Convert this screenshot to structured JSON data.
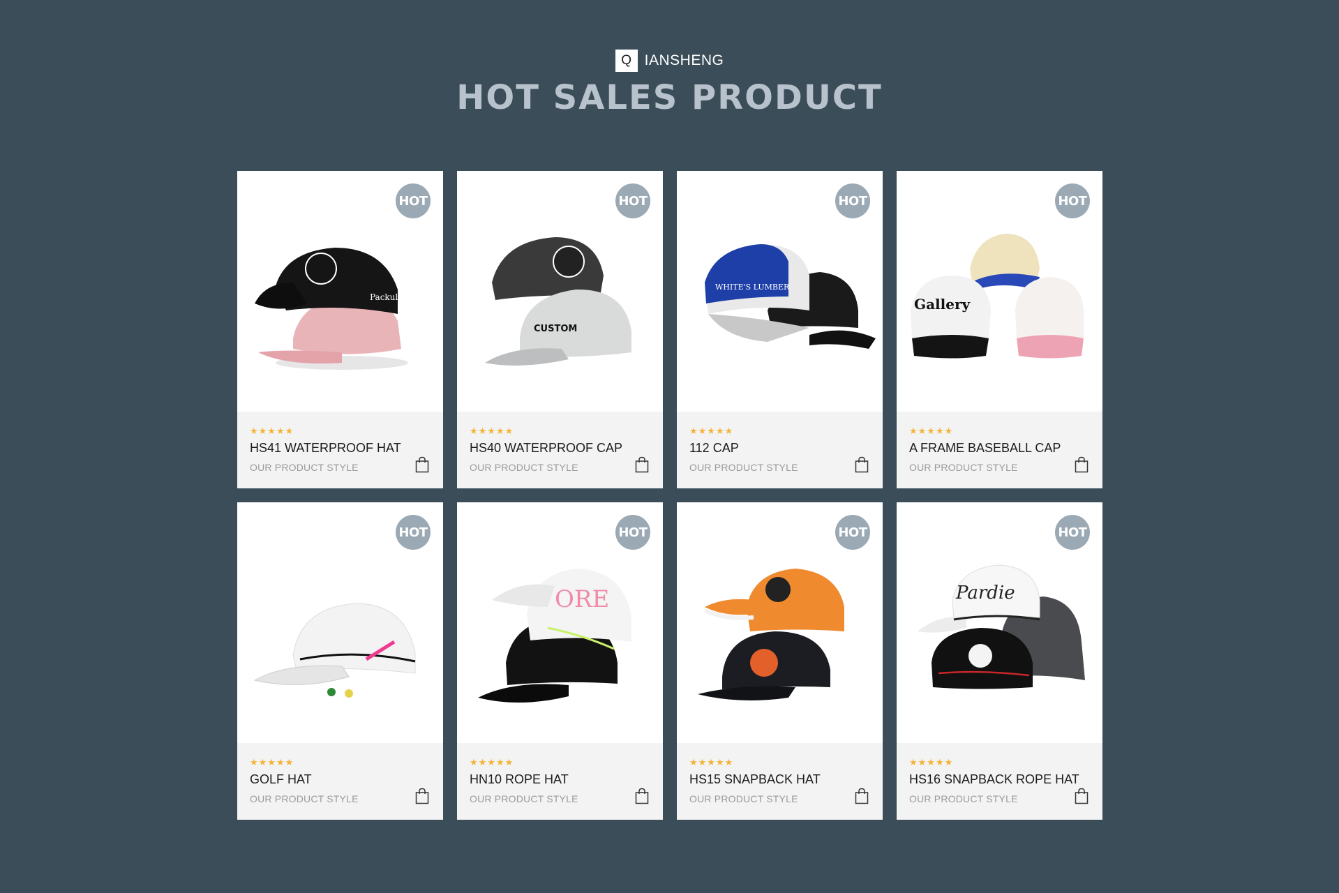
{
  "brand": {
    "logo_letter": "Q",
    "name": "IANSHENG"
  },
  "headline": "HOT SALES PRODUCT",
  "badge_label": "HOT",
  "products": [
    {
      "name": "HS41 WATERPROOF HAT",
      "subtitle": "OUR PRODUCT STYLE",
      "rating": "★★★★★",
      "image_text": "Packul"
    },
    {
      "name": "HS40 WATERPROOF CAP",
      "subtitle": "OUR PRODUCT STYLE",
      "rating": "★★★★★",
      "image_text": "CUSTOM"
    },
    {
      "name": "112 CAP",
      "subtitle": "OUR PRODUCT STYLE",
      "rating": "★★★★★",
      "image_text": "WHITE'S LUMBER"
    },
    {
      "name": "A FRAME BASEBALL CAP",
      "subtitle": "OUR PRODUCT STYLE",
      "rating": "★★★★★",
      "image_text": "Gallery"
    },
    {
      "name": "GOLF HAT",
      "subtitle": "OUR PRODUCT STYLE",
      "rating": "★★★★★",
      "image_text": ""
    },
    {
      "name": "HN10 ROPE HAT",
      "subtitle": "OUR PRODUCT STYLE",
      "rating": "★★★★★",
      "image_text": "ORE"
    },
    {
      "name": "HS15 SNAPBACK HAT",
      "subtitle": "OUR PRODUCT STYLE",
      "rating": "★★★★★",
      "image_text": ""
    },
    {
      "name": "HS16 SNAPBACK ROPE HAT",
      "subtitle": "OUR PRODUCT STYLE",
      "rating": "★★★★★",
      "image_text": "Pardie"
    }
  ],
  "colors": {
    "background": "#3b4d58",
    "headline": "#b8c2cc",
    "badge": "#9aa9b4",
    "stars": "#f5b335"
  }
}
